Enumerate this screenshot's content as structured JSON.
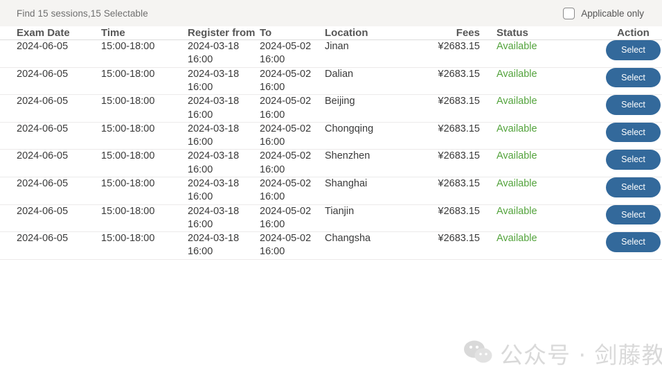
{
  "topbar": {
    "summary": "Find 15 sessions,15 Selectable",
    "filter": {
      "label": "Applicable only",
      "checked": false
    }
  },
  "table": {
    "columns": [
      "Exam Date",
      "Time",
      "Register from",
      "To",
      "Location",
      "Fees",
      "Status",
      "Action"
    ],
    "rows": [
      {
        "exam_date": "2024-06-05",
        "time": "15:00-18:00",
        "register_from": "2024-03-18 16:00",
        "to": "2024-05-02 16:00",
        "location": "Jinan",
        "fees": "¥2683.15",
        "status": "Available",
        "action": "Select"
      },
      {
        "exam_date": "2024-06-05",
        "time": "15:00-18:00",
        "register_from": "2024-03-18 16:00",
        "to": "2024-05-02 16:00",
        "location": "Dalian",
        "fees": "¥2683.15",
        "status": "Available",
        "action": "Select"
      },
      {
        "exam_date": "2024-06-05",
        "time": "15:00-18:00",
        "register_from": "2024-03-18 16:00",
        "to": "2024-05-02 16:00",
        "location": "Beijing",
        "fees": "¥2683.15",
        "status": "Available",
        "action": "Select"
      },
      {
        "exam_date": "2024-06-05",
        "time": "15:00-18:00",
        "register_from": "2024-03-18 16:00",
        "to": "2024-05-02 16:00",
        "location": "Chongqing",
        "fees": "¥2683.15",
        "status": "Available",
        "action": "Select"
      },
      {
        "exam_date": "2024-06-05",
        "time": "15:00-18:00",
        "register_from": "2024-03-18 16:00",
        "to": "2024-05-02 16:00",
        "location": "Shenzhen",
        "fees": "¥2683.15",
        "status": "Available",
        "action": "Select"
      },
      {
        "exam_date": "2024-06-05",
        "time": "15:00-18:00",
        "register_from": "2024-03-18 16:00",
        "to": "2024-05-02 16:00",
        "location": "Shanghai",
        "fees": "¥2683.15",
        "status": "Available",
        "action": "Select"
      },
      {
        "exam_date": "2024-06-05",
        "time": "15:00-18:00",
        "register_from": "2024-03-18 16:00",
        "to": "2024-05-02 16:00",
        "location": "Tianjin",
        "fees": "¥2683.15",
        "status": "Available",
        "action": "Select"
      },
      {
        "exam_date": "2024-06-05",
        "time": "15:00-18:00",
        "register_from": "2024-03-18 16:00",
        "to": "2024-05-02 16:00",
        "location": "Changsha",
        "fees": "¥2683.15",
        "status": "Available",
        "action": "Select"
      }
    ]
  },
  "watermark": {
    "text": "公众号 · 剑藤教育",
    "icon": "wechat-icon"
  },
  "colors": {
    "topbar_background": "#f5f4f2",
    "header_text": "#565656",
    "body_text": "#3a3a3a",
    "status_available": "#53a33c",
    "select_button": "#33699b",
    "row_divider": "#eceaea"
  }
}
